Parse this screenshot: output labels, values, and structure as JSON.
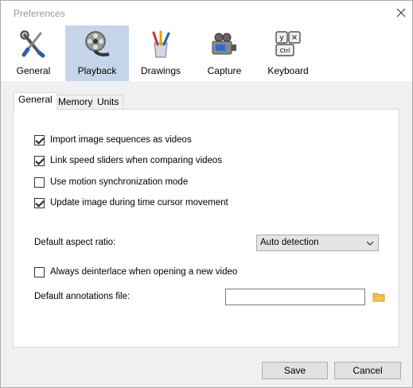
{
  "window": {
    "title": "Preferences"
  },
  "toolbar": {
    "items": [
      {
        "label": "General",
        "icon": "tools-icon"
      },
      {
        "label": "Playback",
        "icon": "film-reel-icon",
        "active": true
      },
      {
        "label": "Drawings",
        "icon": "brushes-icon"
      },
      {
        "label": "Capture",
        "icon": "camera-icon"
      },
      {
        "label": "Keyboard",
        "icon": "keyboard-icon"
      }
    ],
    "keyboard_keys": {
      "y": "y",
      "x": "×",
      "ctrl": "Ctrl"
    }
  },
  "tabs": [
    {
      "label": "General",
      "active": true
    },
    {
      "label": "Memory"
    },
    {
      "label": "Units"
    }
  ],
  "options": {
    "import_sequences": {
      "label": "Import image sequences as videos",
      "checked": true
    },
    "link_speed": {
      "label": "Link speed sliders when comparing videos",
      "checked": true
    },
    "motion_sync": {
      "label": "Use motion synchronization mode",
      "checked": false
    },
    "update_image": {
      "label": "Update image during time cursor movement",
      "checked": true
    },
    "deinterlace": {
      "label": "Always deinterlace when opening a new video",
      "checked": false
    }
  },
  "aspect_ratio": {
    "label": "Default aspect ratio:",
    "value": "Auto detection"
  },
  "annotations": {
    "label": "Default annotations file:",
    "value": ""
  },
  "buttons": {
    "save": "Save",
    "cancel": "Cancel"
  },
  "colors": {
    "active_tool_bg": "#c5d6ea",
    "folder": "#f2c54b"
  }
}
